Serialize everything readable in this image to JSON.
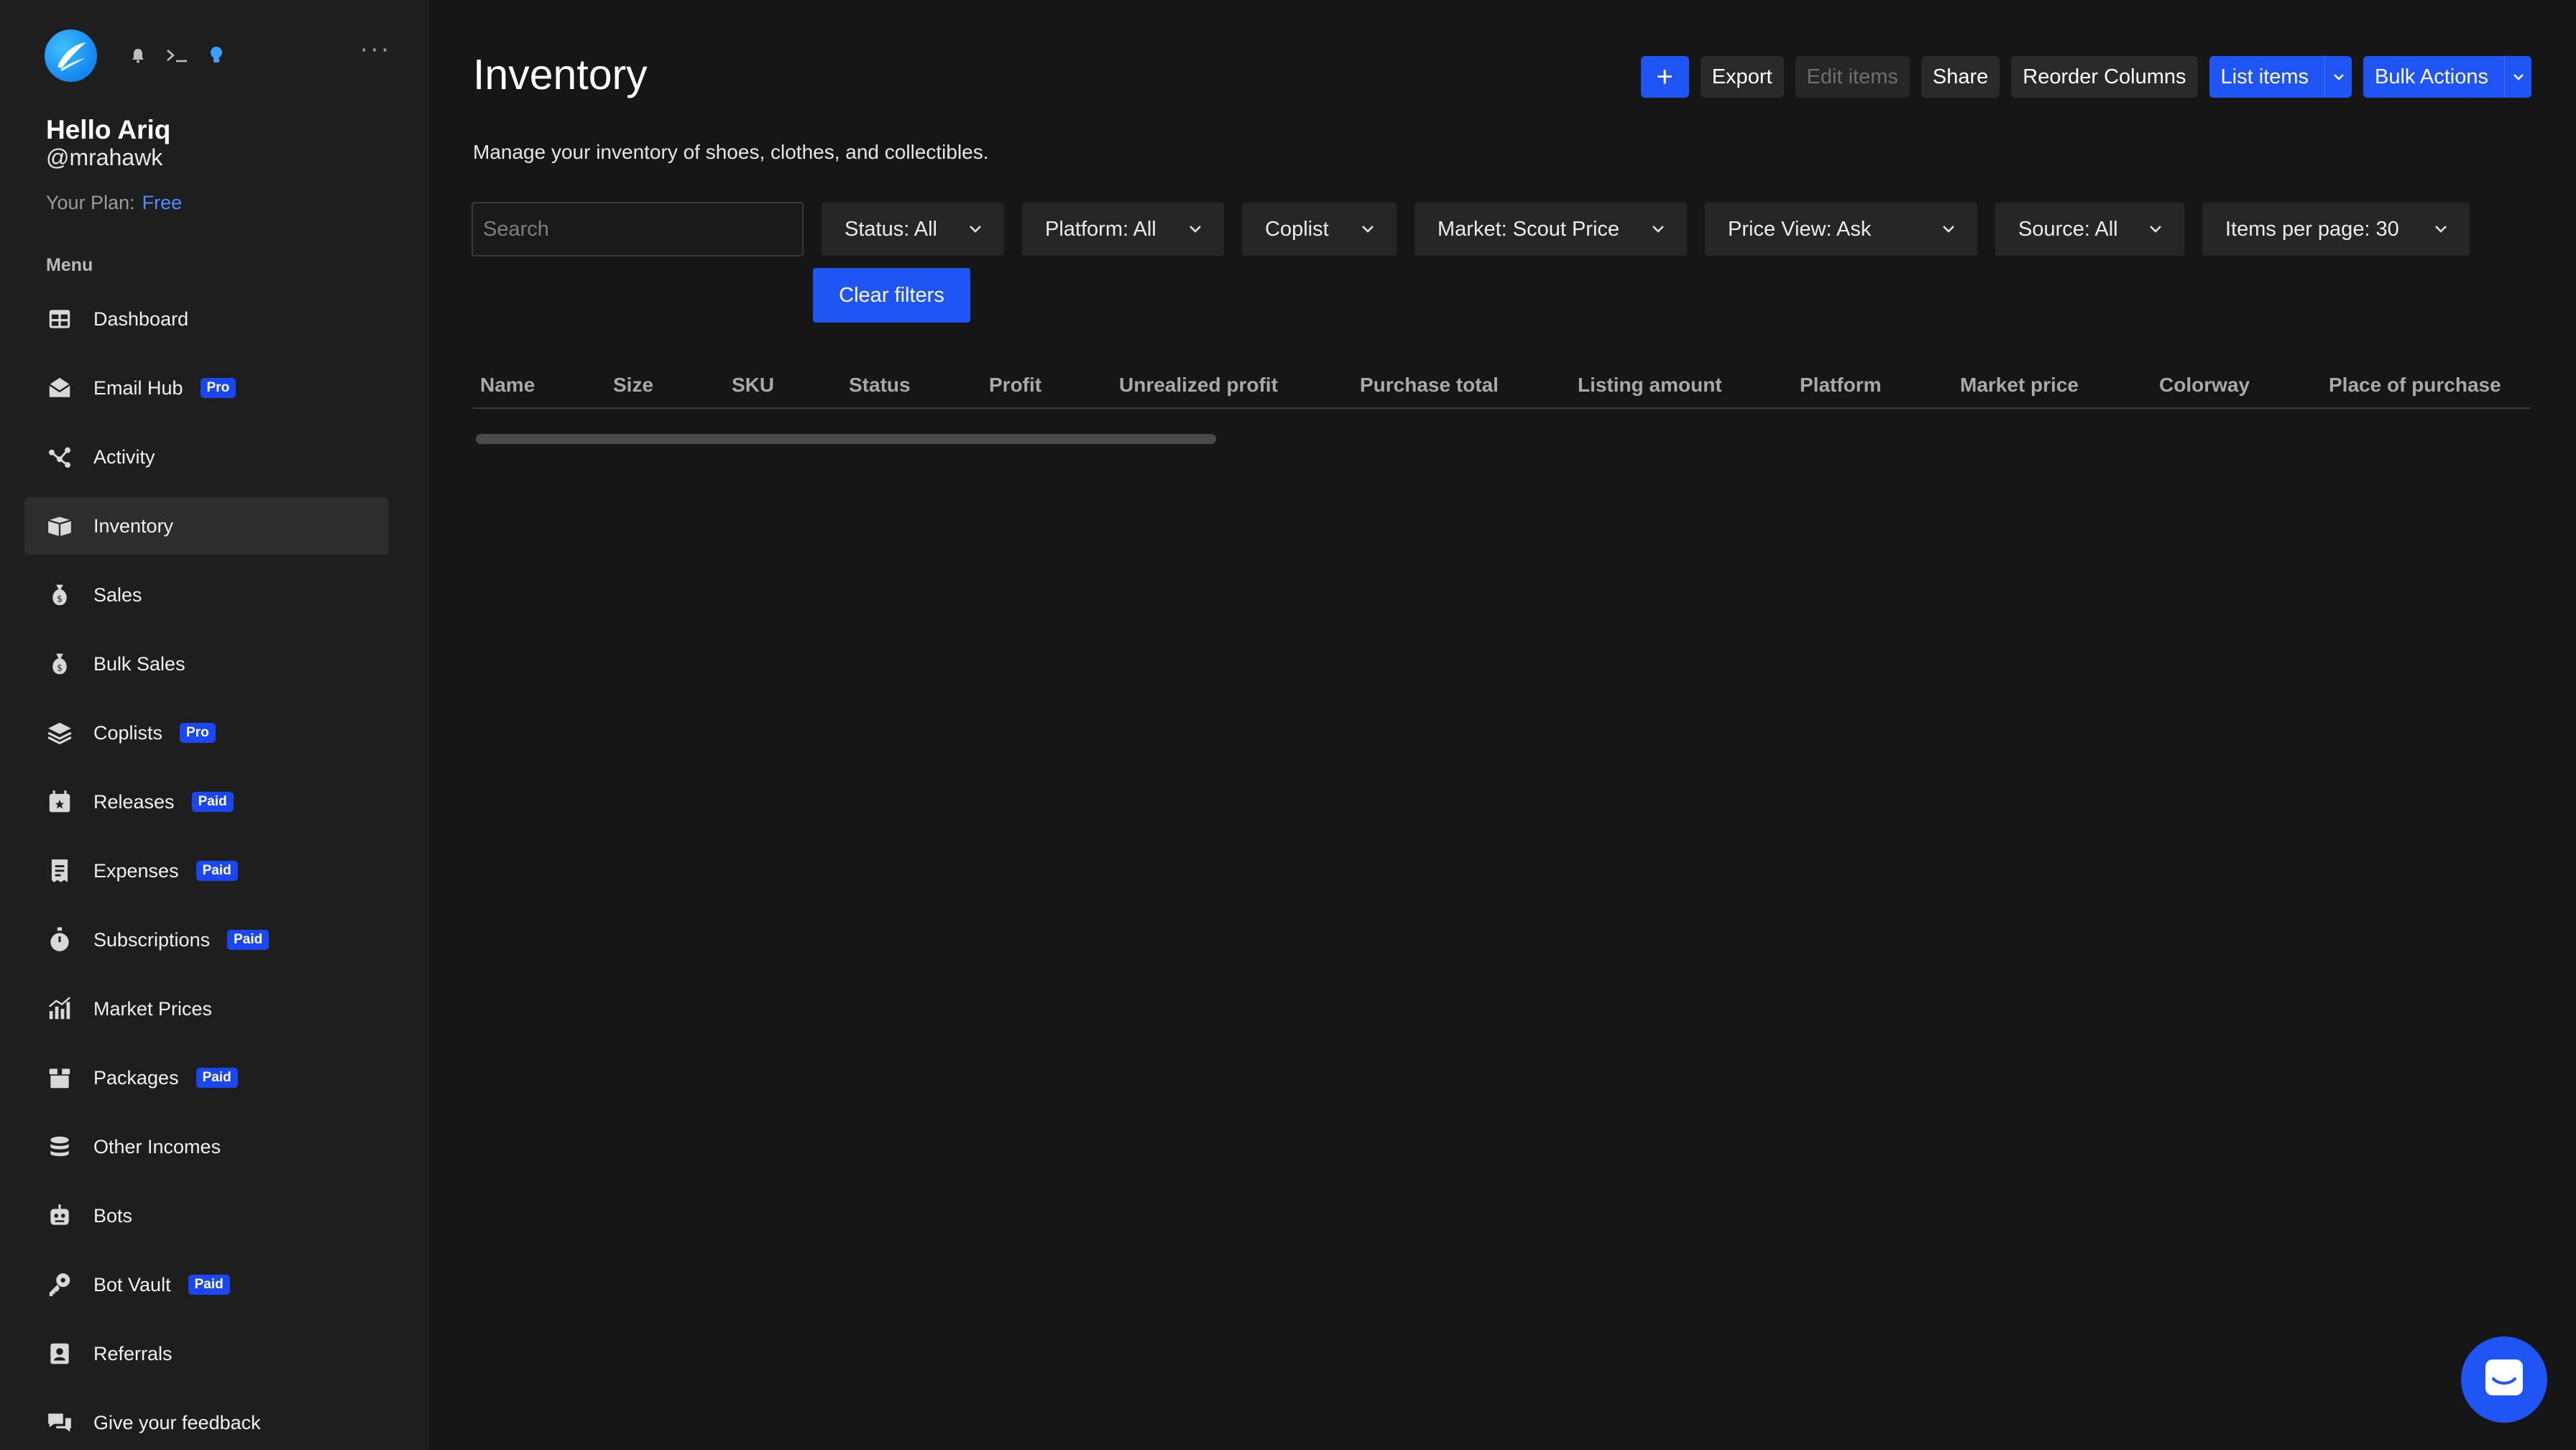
{
  "user": {
    "greeting": "Hello Ariq",
    "handle": "@mrahawk",
    "plan_label": "Your Plan:",
    "plan_value": "Free"
  },
  "sidebar": {
    "menu_heading": "Menu",
    "items": [
      {
        "label": "Dashboard",
        "icon": "dashboard-icon",
        "badge": ""
      },
      {
        "label": "Email Hub",
        "icon": "email-icon",
        "badge": "Pro"
      },
      {
        "label": "Activity",
        "icon": "activity-icon",
        "badge": ""
      },
      {
        "label": "Inventory",
        "icon": "inventory-box-icon",
        "badge": "",
        "active": true
      },
      {
        "label": "Sales",
        "icon": "money-bag-icon",
        "badge": ""
      },
      {
        "label": "Bulk Sales",
        "icon": "money-bag-icon",
        "badge": ""
      },
      {
        "label": "Coplists",
        "icon": "layers-icon",
        "badge": "Pro"
      },
      {
        "label": "Releases",
        "icon": "calendar-star-icon",
        "badge": "Paid"
      },
      {
        "label": "Expenses",
        "icon": "receipt-icon",
        "badge": "Paid"
      },
      {
        "label": "Subscriptions",
        "icon": "stopwatch-icon",
        "badge": "Paid"
      },
      {
        "label": "Market Prices",
        "icon": "bar-chart-icon",
        "badge": ""
      },
      {
        "label": "Packages",
        "icon": "package-icon",
        "badge": "Paid"
      },
      {
        "label": "Other Incomes",
        "icon": "coins-stack-icon",
        "badge": ""
      },
      {
        "label": "Bots",
        "icon": "robot-icon",
        "badge": ""
      },
      {
        "label": "Bot Vault",
        "icon": "key-icon",
        "badge": "Paid"
      },
      {
        "label": "Referrals",
        "icon": "contact-card-icon",
        "badge": ""
      },
      {
        "label": "Give your feedback",
        "icon": "chat-bubbles-icon",
        "badge": ""
      }
    ]
  },
  "header": {
    "title": "Inventory",
    "description": "Manage your inventory of shoes, clothes, and collectibles."
  },
  "toolbar": {
    "add_label": "+",
    "export_label": "Export",
    "edit_label": "Edit items",
    "share_label": "Share",
    "reorder_label": "Reorder Columns",
    "list_label": "List items",
    "bulk_label": "Bulk Actions"
  },
  "filters": {
    "search_placeholder": "Search",
    "status": "Status: All",
    "platform": "Platform: All",
    "coplist": "Coplist",
    "market": "Market: Scout Price",
    "price_view": "Price View: Ask",
    "source": "Source: All",
    "per_page": "Items per page: 30",
    "clear_label": "Clear filters"
  },
  "table": {
    "columns": [
      "Name",
      "Size",
      "SKU",
      "Status",
      "Profit",
      "Unrealized profit",
      "Purchase total",
      "Listing amount",
      "Platform",
      "Market price",
      "Colorway",
      "Place of purchase"
    ]
  },
  "colors": {
    "accent": "#1f55f5",
    "background": "#161616",
    "sidebar": "#1e1e1e",
    "badge": "#1a47f0"
  }
}
